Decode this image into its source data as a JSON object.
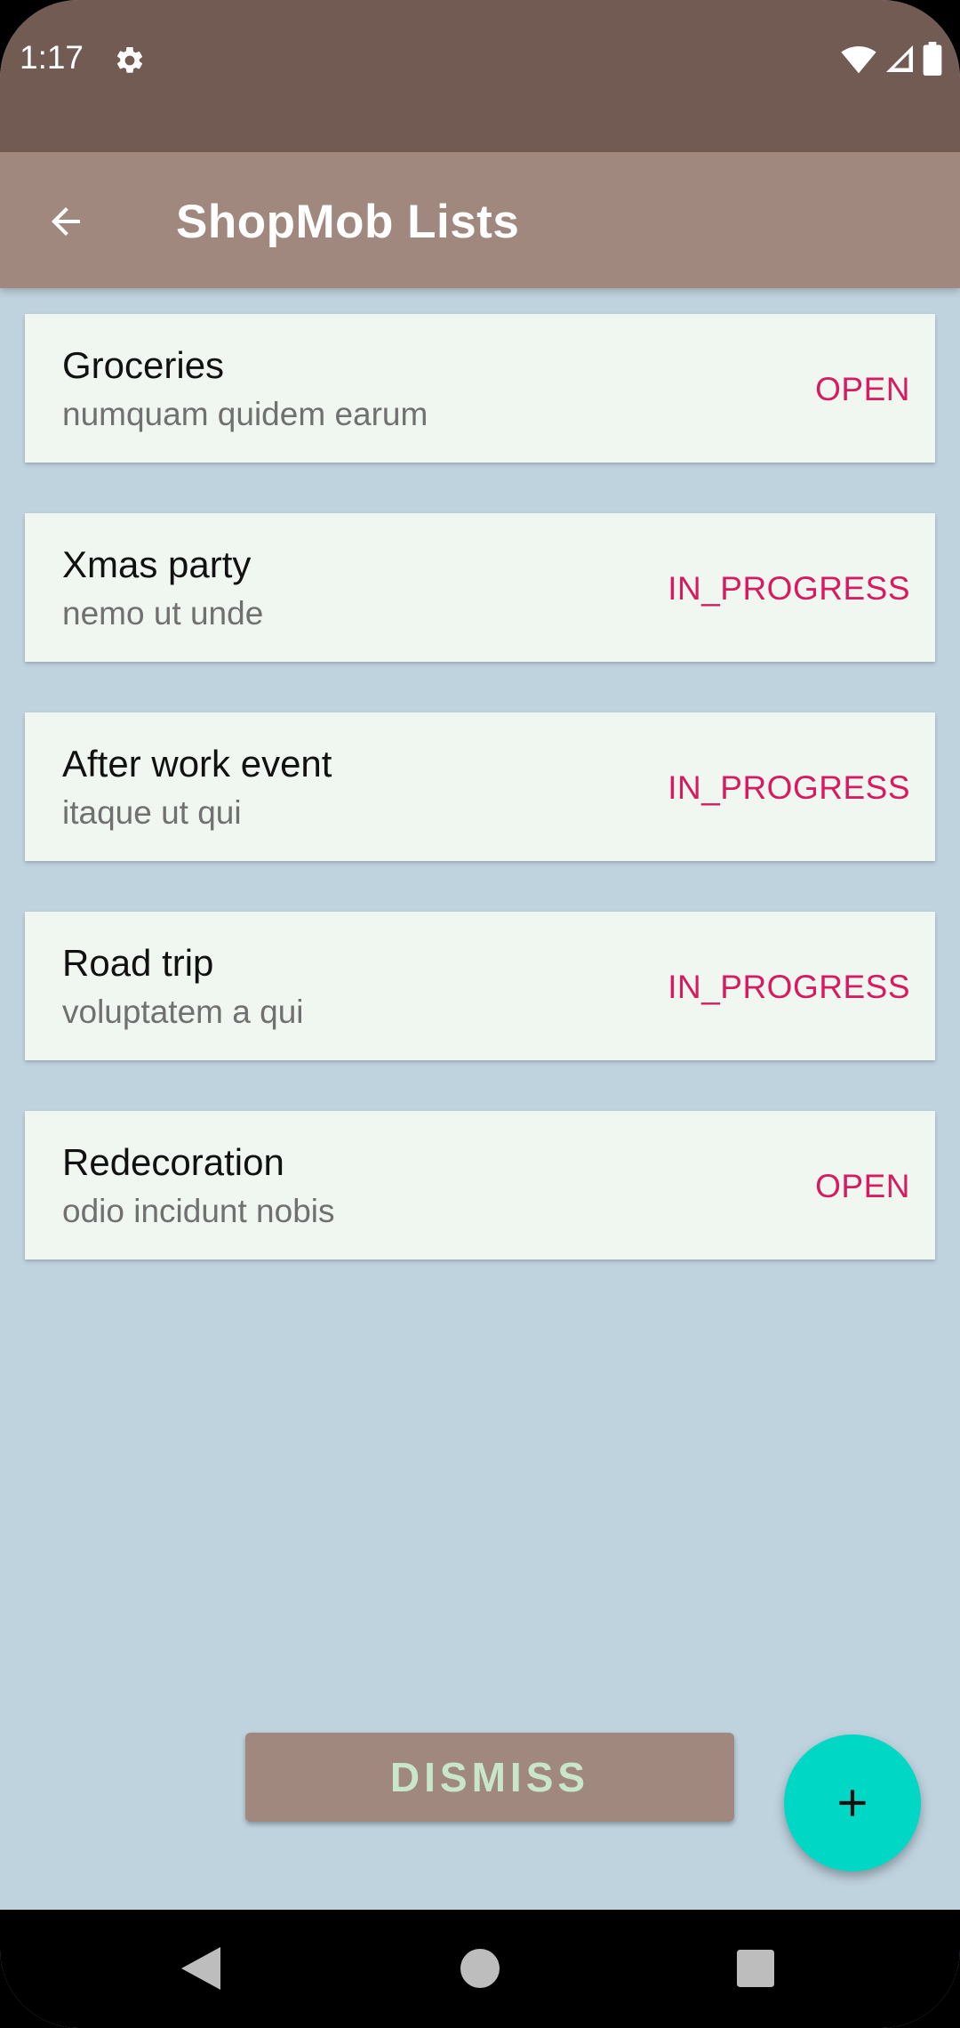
{
  "status_bar": {
    "time": "1:17",
    "icons": [
      "gear-icon",
      "wifi-icon",
      "signal-icon",
      "battery-icon"
    ]
  },
  "app_bar": {
    "title": "ShopMob Lists",
    "back_icon": "arrow-left-icon"
  },
  "lists": [
    {
      "title": "Groceries",
      "subtitle": "numquam quidem earum",
      "status": "OPEN"
    },
    {
      "title": "Xmas party",
      "subtitle": "nemo ut unde",
      "status": "IN_PROGRESS"
    },
    {
      "title": "After work event",
      "subtitle": "itaque ut qui",
      "status": "IN_PROGRESS"
    },
    {
      "title": "Road trip",
      "subtitle": "voluptatem a qui",
      "status": "IN_PROGRESS"
    },
    {
      "title": "Redecoration",
      "subtitle": "odio incidunt nobis",
      "status": "OPEN"
    }
  ],
  "dismiss_label": "DISMISS",
  "fab_icon": "plus-icon",
  "nav_bar": {
    "icons": [
      "back-triangle-icon",
      "home-circle-icon",
      "recents-square-icon"
    ]
  },
  "colors": {
    "status_bar": "#725b53",
    "app_bar": "#a1887f",
    "background": "#bfd3df",
    "card": "#eff7f0",
    "status_text": "#d81b60",
    "fab": "#00d8c5",
    "dismiss_text": "#c8e6c9"
  }
}
